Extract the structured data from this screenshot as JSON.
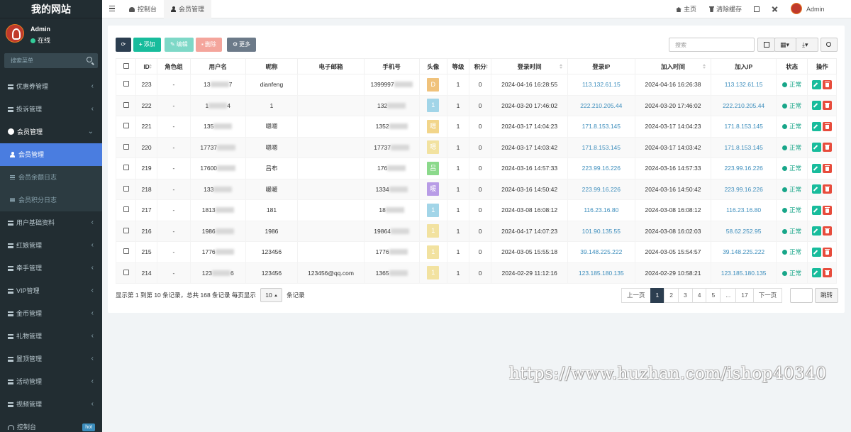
{
  "site": {
    "title": "我的网站"
  },
  "user": {
    "name": "Admin",
    "status": "在线"
  },
  "sidebar": {
    "search_placeholder": "搜索菜单",
    "items": [
      {
        "label": "优惠券管理"
      },
      {
        "label": "投诉管理"
      },
      {
        "label": "会员管理"
      },
      {
        "label": "用户基础资料"
      },
      {
        "label": "红娘管理"
      },
      {
        "label": "牵手管理"
      },
      {
        "label": "VIP管理"
      },
      {
        "label": "金币管理"
      },
      {
        "label": "礼物管理"
      },
      {
        "label": "置顶管理"
      },
      {
        "label": "活动管理"
      },
      {
        "label": "视频管理"
      },
      {
        "label": "控制台",
        "badge": "hot"
      }
    ],
    "subitems": [
      {
        "label": "会员管理"
      },
      {
        "label": "会员余额日志"
      },
      {
        "label": "会员积分日志"
      }
    ]
  },
  "topbar": {
    "tabs": [
      {
        "label": "控制台"
      },
      {
        "label": "会员管理"
      }
    ],
    "home": "主页",
    "clear_cache": "清除缓存",
    "admin": "Admin"
  },
  "toolbar": {
    "add": "添加",
    "edit": "编辑",
    "delete": "删除",
    "more": "更多",
    "search_placeholder": "搜索",
    "colors": {
      "refresh": "#2c3e50",
      "add": "#18bc9c",
      "edit": "#7ed8c7",
      "delete": "#f4a59c",
      "more": "#6c7a89"
    }
  },
  "table": {
    "headers": [
      "ID",
      "角色组",
      "用户名",
      "昵称",
      "电子邮箱",
      "手机号",
      "头像",
      "等级",
      "积分",
      "登录时间",
      "登录IP",
      "加入时间",
      "加入IP",
      "状态",
      "操作"
    ],
    "rows": [
      {
        "id": "223",
        "group": "-",
        "username": "13",
        "username2": "7",
        "nickname": "dianfeng",
        "email": "",
        "mobile": "1399997",
        "avatar": "D",
        "avatar_color": "#f0c27b",
        "level": "1",
        "score": "0",
        "logintime": "2024-04-16 16:28:55",
        "loginip": "113.132.61.15",
        "jointime": "2024-04-16 16:26:38",
        "joinip": "113.132.61.15",
        "status": "正常"
      },
      {
        "id": "222",
        "group": "-",
        "username": "1",
        "username2": "4",
        "nickname": "1",
        "email": "",
        "mobile": "132",
        "avatar": "1",
        "avatar_color": "#a2d5e8",
        "level": "1",
        "score": "0",
        "logintime": "2024-03-20 17:46:02",
        "loginip": "222.210.205.44",
        "jointime": "2024-03-20 17:46:02",
        "joinip": "222.210.205.44",
        "status": "正常"
      },
      {
        "id": "221",
        "group": "-",
        "username": "135",
        "username2": "",
        "nickname": "嗯嗯",
        "email": "",
        "mobile": "1352",
        "avatar": "嗯",
        "avatar_color": "#f2d58a",
        "level": "1",
        "score": "0",
        "logintime": "2024-03-17 14:04:23",
        "loginip": "171.8.153.145",
        "jointime": "2024-03-17 14:04:23",
        "joinip": "171.8.153.145",
        "status": "正常"
      },
      {
        "id": "220",
        "group": "-",
        "username": "17737",
        "username2": "",
        "nickname": "嗯嗯",
        "email": "",
        "mobile": "17737",
        "avatar": "嗯",
        "avatar_color": "#f2e2a0",
        "level": "1",
        "score": "0",
        "logintime": "2024-03-17 14:03:42",
        "loginip": "171.8.153.145",
        "jointime": "2024-03-17 14:03:42",
        "joinip": "171.8.153.145",
        "status": "正常"
      },
      {
        "id": "219",
        "group": "-",
        "username": "17600",
        "username2": "",
        "nickname": "吕布",
        "email": "",
        "mobile": "176",
        "avatar": "吕",
        "avatar_color": "#8bd98b",
        "level": "1",
        "score": "0",
        "logintime": "2024-03-16 14:57:33",
        "loginip": "223.99.16.226",
        "jointime": "2024-03-16 14:57:33",
        "joinip": "223.99.16.226",
        "status": "正常"
      },
      {
        "id": "218",
        "group": "-",
        "username": "133",
        "username2": "",
        "nickname": "暖暖",
        "email": "",
        "mobile": "1334",
        "avatar": "暖",
        "avatar_color": "#b89ce6",
        "level": "1",
        "score": "0",
        "logintime": "2024-03-16 14:50:42",
        "loginip": "223.99.16.226",
        "jointime": "2024-03-16 14:50:42",
        "joinip": "223.99.16.226",
        "status": "正常"
      },
      {
        "id": "217",
        "group": "-",
        "username": "1813",
        "username2": "",
        "nickname": "181",
        "email": "",
        "mobile": "18",
        "avatar": "1",
        "avatar_color": "#a2d5e8",
        "level": "1",
        "score": "0",
        "logintime": "2024-03-08 16:08:12",
        "loginip": "116.23.16.80",
        "jointime": "2024-03-08 16:08:12",
        "joinip": "116.23.16.80",
        "status": "正常"
      },
      {
        "id": "216",
        "group": "-",
        "username": "1986",
        "username2": "",
        "nickname": "1986",
        "email": "",
        "mobile": "19864",
        "avatar": "1",
        "avatar_color": "#f2e2a0",
        "level": "1",
        "score": "0",
        "logintime": "2024-04-17 14:07:23",
        "loginip": "101.90.135.55",
        "jointime": "2024-03-08 16:02:03",
        "joinip": "58.62.252.95",
        "status": "正常"
      },
      {
        "id": "215",
        "group": "-",
        "username": "1776",
        "username2": "",
        "nickname": "123456",
        "email": "",
        "mobile": "1776",
        "avatar": "1",
        "avatar_color": "#f2e2a0",
        "level": "1",
        "score": "0",
        "logintime": "2024-03-05 15:55:18",
        "loginip": "39.148.225.222",
        "jointime": "2024-03-05 15:54:57",
        "joinip": "39.148.225.222",
        "status": "正常"
      },
      {
        "id": "214",
        "group": "-",
        "username": "123",
        "username2": "6",
        "nickname": "123456",
        "email": "123456@qq.com",
        "mobile": "1365",
        "avatar": "1",
        "avatar_color": "#f2e2a0",
        "level": "1",
        "score": "0",
        "logintime": "2024-02-29 11:12:16",
        "loginip": "123.185.180.135",
        "jointime": "2024-02-29 10:58:21",
        "joinip": "123.185.180.135",
        "status": "正常"
      }
    ]
  },
  "pagination": {
    "info_prefix": "显示第 1 到第 10 条记录，总共 168 条记录 每页显示",
    "page_size": "10",
    "info_suffix": "条记录",
    "prev": "上一页",
    "pages": [
      "1",
      "2",
      "3",
      "4",
      "5",
      "...",
      "17"
    ],
    "next": "下一页",
    "jump": "跳转"
  },
  "watermark": "https://www.huzhan.com/ishop40340"
}
